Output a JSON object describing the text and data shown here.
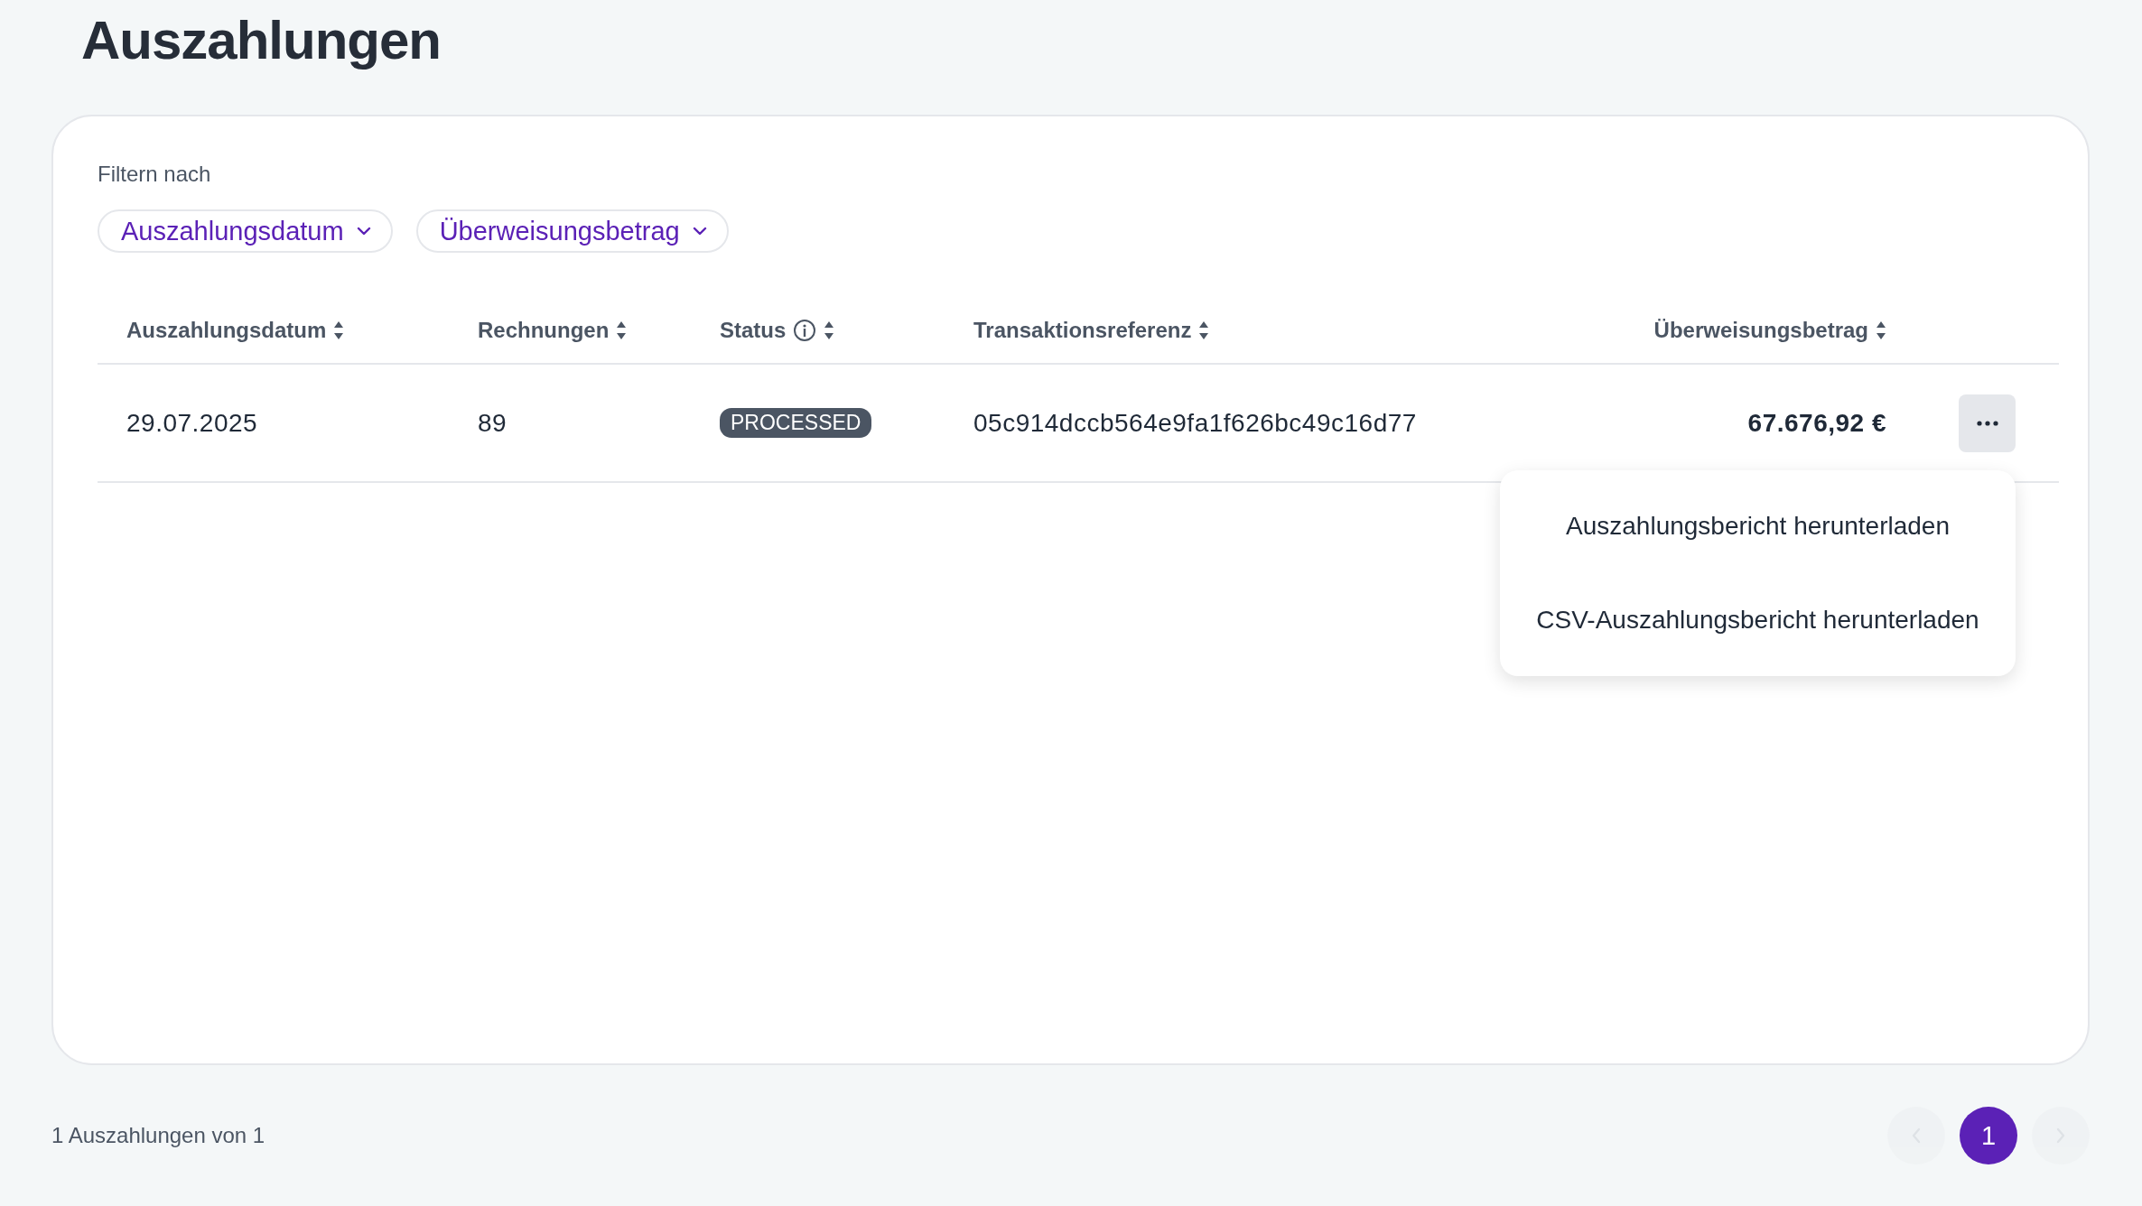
{
  "page_title": "Auszahlungen",
  "filters": {
    "label": "Filtern nach",
    "items": [
      {
        "label": "Auszahlungsdatum"
      },
      {
        "label": "Überweisungsbetrag"
      }
    ]
  },
  "table": {
    "columns": [
      {
        "label": "Auszahlungsdatum",
        "kind": "text",
        "has_info": false
      },
      {
        "label": "Rechnungen",
        "kind": "text",
        "has_info": false
      },
      {
        "label": "Status",
        "kind": "badge",
        "has_info": true
      },
      {
        "label": "Transaktionsreferenz",
        "kind": "text",
        "has_info": false
      },
      {
        "label": "Überweisungsbetrag",
        "kind": "amount",
        "has_info": false
      }
    ],
    "rows": [
      {
        "cells": [
          "29.07.2025",
          "89",
          "PROCESSED",
          "05c914dccb564e9fa1f626bc49c16d77",
          "67.676,92 €"
        ],
        "menu_open": true
      }
    ]
  },
  "row_menu": {
    "items": [
      {
        "label": "Auszahlungsbericht herunterladen"
      },
      {
        "label": "CSV-Auszahlungsbericht herunterladen"
      }
    ]
  },
  "pagination": {
    "summary": "1 Auszahlungen von 1",
    "prev_disabled": true,
    "next_disabled": true,
    "pages": [
      {
        "label": "1",
        "selected": true
      }
    ]
  }
}
